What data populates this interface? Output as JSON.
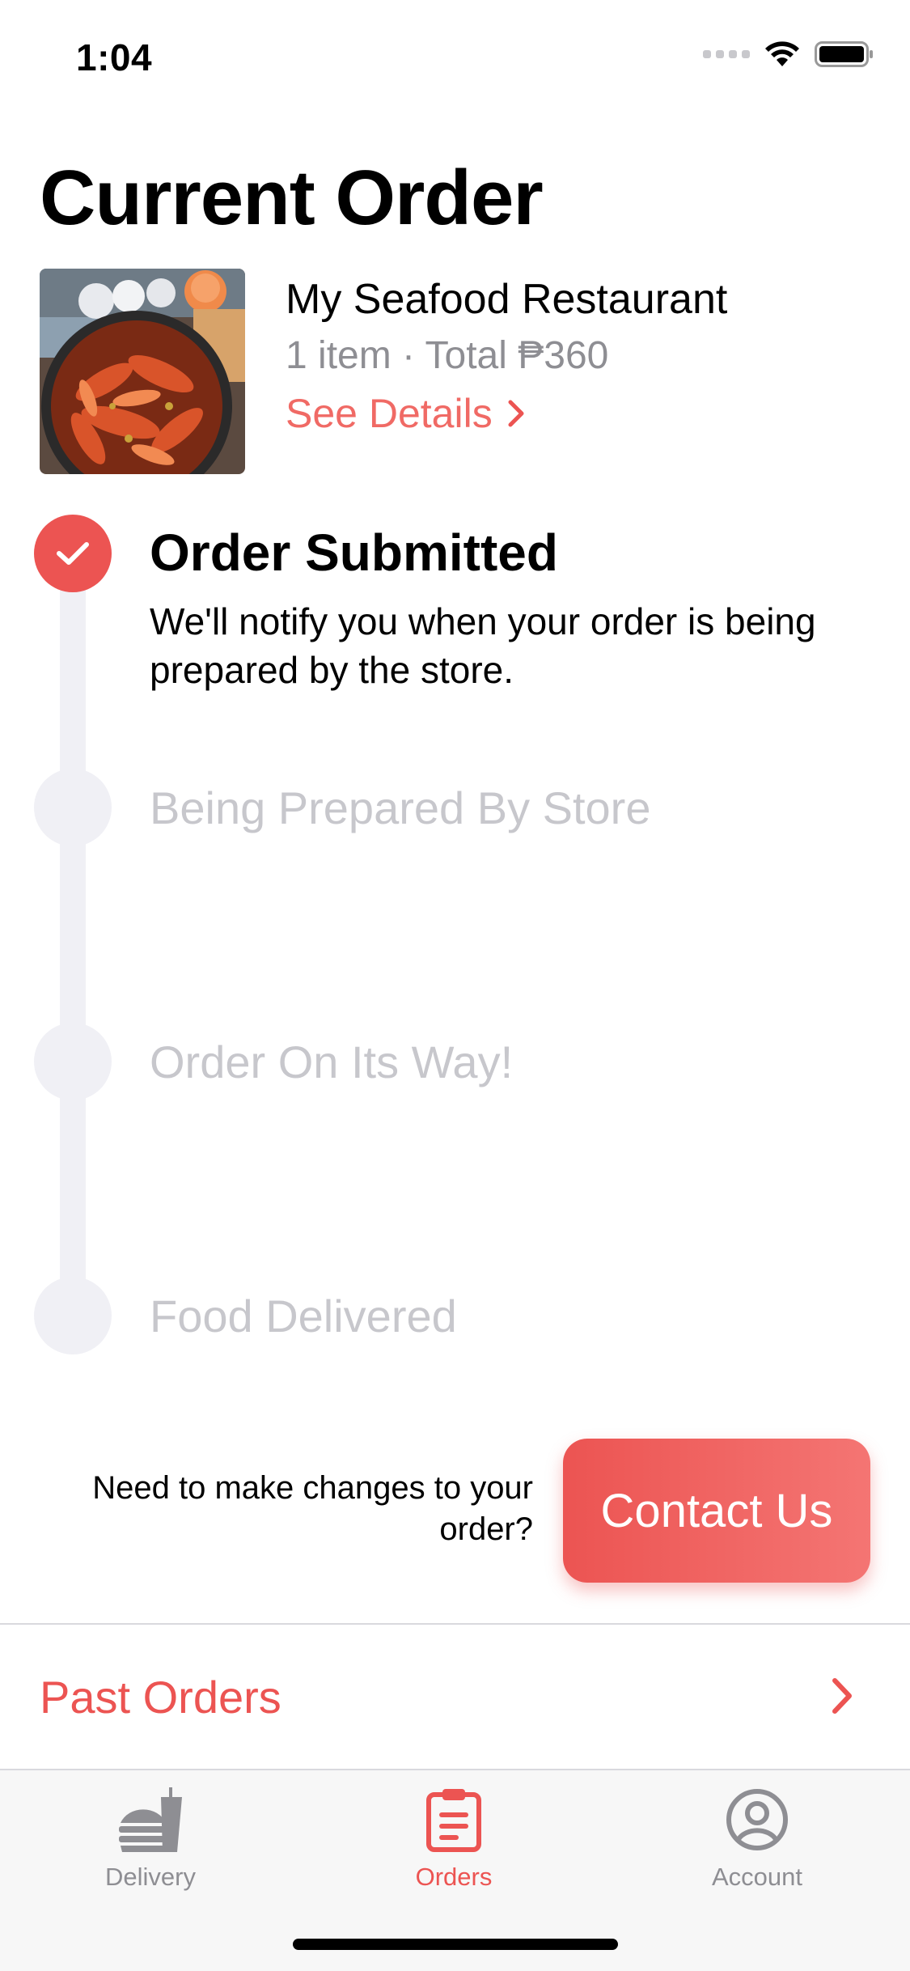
{
  "status_bar": {
    "time": "1:04"
  },
  "page": {
    "title": "Current Order"
  },
  "order": {
    "restaurant_name": "My Seafood Restaurant",
    "meta": "1 item · Total ₱360",
    "see_details_label": "See Details"
  },
  "timeline": {
    "steps": [
      {
        "title": "Order Submitted",
        "description": "We'll notify you when your order is being prepared by the store.",
        "state": "done"
      },
      {
        "title": "Being Prepared By Store",
        "state": "pending"
      },
      {
        "title": "Order On Its Way!",
        "state": "pending"
      },
      {
        "title": "Food Delivered",
        "state": "pending"
      }
    ]
  },
  "contact": {
    "prompt": "Need to make changes to your order?",
    "button_label": "Contact Us"
  },
  "past_orders": {
    "label": "Past Orders"
  },
  "tab_bar": {
    "tabs": [
      {
        "label": "Delivery",
        "icon": "delivery-icon",
        "active": false
      },
      {
        "label": "Orders",
        "icon": "clipboard-icon",
        "active": true
      },
      {
        "label": "Account",
        "icon": "account-icon",
        "active": false
      }
    ]
  },
  "colors": {
    "accent": "#ec5452",
    "muted": "#8e8e93",
    "pending": "#c7c7cc",
    "track": "#f0f0f5"
  }
}
